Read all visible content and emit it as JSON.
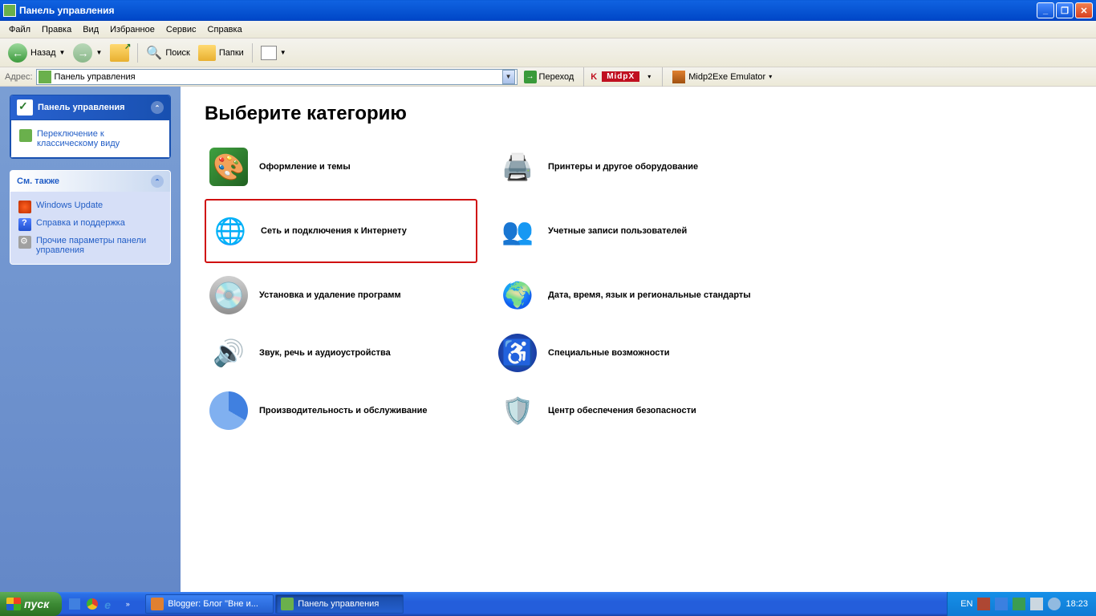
{
  "window": {
    "title": "Панель управления"
  },
  "menu": {
    "items": [
      "Файл",
      "Правка",
      "Вид",
      "Избранное",
      "Сервис",
      "Справка"
    ]
  },
  "toolbar": {
    "back": "Назад",
    "search": "Поиск",
    "folders": "Папки"
  },
  "addressbar": {
    "label": "Адрес:",
    "value": "Панель управления",
    "go": "Переход",
    "kaspersky": "K MidpX",
    "midpx": "Midp2Exe Emulator"
  },
  "sidebar": {
    "panel1": {
      "title": "Панель управления",
      "items": [
        "Переключение к классическому виду"
      ]
    },
    "panel2": {
      "title": "См. также",
      "items": [
        "Windows Update",
        "Справка и поддержка",
        "Прочие параметры панели управления"
      ]
    }
  },
  "content": {
    "heading": "Выберите категорию",
    "categories": [
      {
        "label": "Оформление и темы",
        "icon": "appearance"
      },
      {
        "label": "Принтеры и другое оборудование",
        "icon": "printers"
      },
      {
        "label": "Сеть и подключения к Интернету",
        "icon": "network",
        "highlighted": true
      },
      {
        "label": "Учетные записи пользователей",
        "icon": "users"
      },
      {
        "label": "Установка и удаление программ",
        "icon": "programs"
      },
      {
        "label": "Дата, время, язык и региональные стандарты",
        "icon": "date"
      },
      {
        "label": "Звук, речь и аудиоустройства",
        "icon": "sound"
      },
      {
        "label": "Специальные возможности",
        "icon": "access"
      },
      {
        "label": "Производительность и обслуживание",
        "icon": "perf"
      },
      {
        "label": "Центр обеспечения безопасности",
        "icon": "security"
      }
    ]
  },
  "taskbar": {
    "start": "пуск",
    "tasks": [
      {
        "label": "Blogger: Блог \"Вне и...",
        "icon": "opera"
      },
      {
        "label": "Панель управления",
        "icon": "cp",
        "active": true
      }
    ],
    "lang": "EN",
    "time": "18:23"
  }
}
